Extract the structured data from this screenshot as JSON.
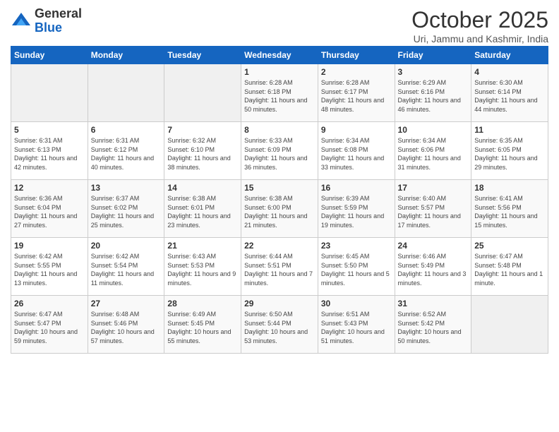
{
  "logo": {
    "line1": "General",
    "line2": "Blue"
  },
  "header": {
    "month": "October 2025",
    "location": "Uri, Jammu and Kashmir, India"
  },
  "weekdays": [
    "Sunday",
    "Monday",
    "Tuesday",
    "Wednesday",
    "Thursday",
    "Friday",
    "Saturday"
  ],
  "weeks": [
    [
      {
        "day": "",
        "sunrise": "",
        "sunset": "",
        "daylight": ""
      },
      {
        "day": "",
        "sunrise": "",
        "sunset": "",
        "daylight": ""
      },
      {
        "day": "",
        "sunrise": "",
        "sunset": "",
        "daylight": ""
      },
      {
        "day": "1",
        "sunrise": "Sunrise: 6:28 AM",
        "sunset": "Sunset: 6:18 PM",
        "daylight": "Daylight: 11 hours and 50 minutes."
      },
      {
        "day": "2",
        "sunrise": "Sunrise: 6:28 AM",
        "sunset": "Sunset: 6:17 PM",
        "daylight": "Daylight: 11 hours and 48 minutes."
      },
      {
        "day": "3",
        "sunrise": "Sunrise: 6:29 AM",
        "sunset": "Sunset: 6:16 PM",
        "daylight": "Daylight: 11 hours and 46 minutes."
      },
      {
        "day": "4",
        "sunrise": "Sunrise: 6:30 AM",
        "sunset": "Sunset: 6:14 PM",
        "daylight": "Daylight: 11 hours and 44 minutes."
      }
    ],
    [
      {
        "day": "5",
        "sunrise": "Sunrise: 6:31 AM",
        "sunset": "Sunset: 6:13 PM",
        "daylight": "Daylight: 11 hours and 42 minutes."
      },
      {
        "day": "6",
        "sunrise": "Sunrise: 6:31 AM",
        "sunset": "Sunset: 6:12 PM",
        "daylight": "Daylight: 11 hours and 40 minutes."
      },
      {
        "day": "7",
        "sunrise": "Sunrise: 6:32 AM",
        "sunset": "Sunset: 6:10 PM",
        "daylight": "Daylight: 11 hours and 38 minutes."
      },
      {
        "day": "8",
        "sunrise": "Sunrise: 6:33 AM",
        "sunset": "Sunset: 6:09 PM",
        "daylight": "Daylight: 11 hours and 36 minutes."
      },
      {
        "day": "9",
        "sunrise": "Sunrise: 6:34 AM",
        "sunset": "Sunset: 6:08 PM",
        "daylight": "Daylight: 11 hours and 33 minutes."
      },
      {
        "day": "10",
        "sunrise": "Sunrise: 6:34 AM",
        "sunset": "Sunset: 6:06 PM",
        "daylight": "Daylight: 11 hours and 31 minutes."
      },
      {
        "day": "11",
        "sunrise": "Sunrise: 6:35 AM",
        "sunset": "Sunset: 6:05 PM",
        "daylight": "Daylight: 11 hours and 29 minutes."
      }
    ],
    [
      {
        "day": "12",
        "sunrise": "Sunrise: 6:36 AM",
        "sunset": "Sunset: 6:04 PM",
        "daylight": "Daylight: 11 hours and 27 minutes."
      },
      {
        "day": "13",
        "sunrise": "Sunrise: 6:37 AM",
        "sunset": "Sunset: 6:02 PM",
        "daylight": "Daylight: 11 hours and 25 minutes."
      },
      {
        "day": "14",
        "sunrise": "Sunrise: 6:38 AM",
        "sunset": "Sunset: 6:01 PM",
        "daylight": "Daylight: 11 hours and 23 minutes."
      },
      {
        "day": "15",
        "sunrise": "Sunrise: 6:38 AM",
        "sunset": "Sunset: 6:00 PM",
        "daylight": "Daylight: 11 hours and 21 minutes."
      },
      {
        "day": "16",
        "sunrise": "Sunrise: 6:39 AM",
        "sunset": "Sunset: 5:59 PM",
        "daylight": "Daylight: 11 hours and 19 minutes."
      },
      {
        "day": "17",
        "sunrise": "Sunrise: 6:40 AM",
        "sunset": "Sunset: 5:57 PM",
        "daylight": "Daylight: 11 hours and 17 minutes."
      },
      {
        "day": "18",
        "sunrise": "Sunrise: 6:41 AM",
        "sunset": "Sunset: 5:56 PM",
        "daylight": "Daylight: 11 hours and 15 minutes."
      }
    ],
    [
      {
        "day": "19",
        "sunrise": "Sunrise: 6:42 AM",
        "sunset": "Sunset: 5:55 PM",
        "daylight": "Daylight: 11 hours and 13 minutes."
      },
      {
        "day": "20",
        "sunrise": "Sunrise: 6:42 AM",
        "sunset": "Sunset: 5:54 PM",
        "daylight": "Daylight: 11 hours and 11 minutes."
      },
      {
        "day": "21",
        "sunrise": "Sunrise: 6:43 AM",
        "sunset": "Sunset: 5:53 PM",
        "daylight": "Daylight: 11 hours and 9 minutes."
      },
      {
        "day": "22",
        "sunrise": "Sunrise: 6:44 AM",
        "sunset": "Sunset: 5:51 PM",
        "daylight": "Daylight: 11 hours and 7 minutes."
      },
      {
        "day": "23",
        "sunrise": "Sunrise: 6:45 AM",
        "sunset": "Sunset: 5:50 PM",
        "daylight": "Daylight: 11 hours and 5 minutes."
      },
      {
        "day": "24",
        "sunrise": "Sunrise: 6:46 AM",
        "sunset": "Sunset: 5:49 PM",
        "daylight": "Daylight: 11 hours and 3 minutes."
      },
      {
        "day": "25",
        "sunrise": "Sunrise: 6:47 AM",
        "sunset": "Sunset: 5:48 PM",
        "daylight": "Daylight: 11 hours and 1 minute."
      }
    ],
    [
      {
        "day": "26",
        "sunrise": "Sunrise: 6:47 AM",
        "sunset": "Sunset: 5:47 PM",
        "daylight": "Daylight: 10 hours and 59 minutes."
      },
      {
        "day": "27",
        "sunrise": "Sunrise: 6:48 AM",
        "sunset": "Sunset: 5:46 PM",
        "daylight": "Daylight: 10 hours and 57 minutes."
      },
      {
        "day": "28",
        "sunrise": "Sunrise: 6:49 AM",
        "sunset": "Sunset: 5:45 PM",
        "daylight": "Daylight: 10 hours and 55 minutes."
      },
      {
        "day": "29",
        "sunrise": "Sunrise: 6:50 AM",
        "sunset": "Sunset: 5:44 PM",
        "daylight": "Daylight: 10 hours and 53 minutes."
      },
      {
        "day": "30",
        "sunrise": "Sunrise: 6:51 AM",
        "sunset": "Sunset: 5:43 PM",
        "daylight": "Daylight: 10 hours and 51 minutes."
      },
      {
        "day": "31",
        "sunrise": "Sunrise: 6:52 AM",
        "sunset": "Sunset: 5:42 PM",
        "daylight": "Daylight: 10 hours and 50 minutes."
      },
      {
        "day": "",
        "sunrise": "",
        "sunset": "",
        "daylight": ""
      }
    ]
  ]
}
